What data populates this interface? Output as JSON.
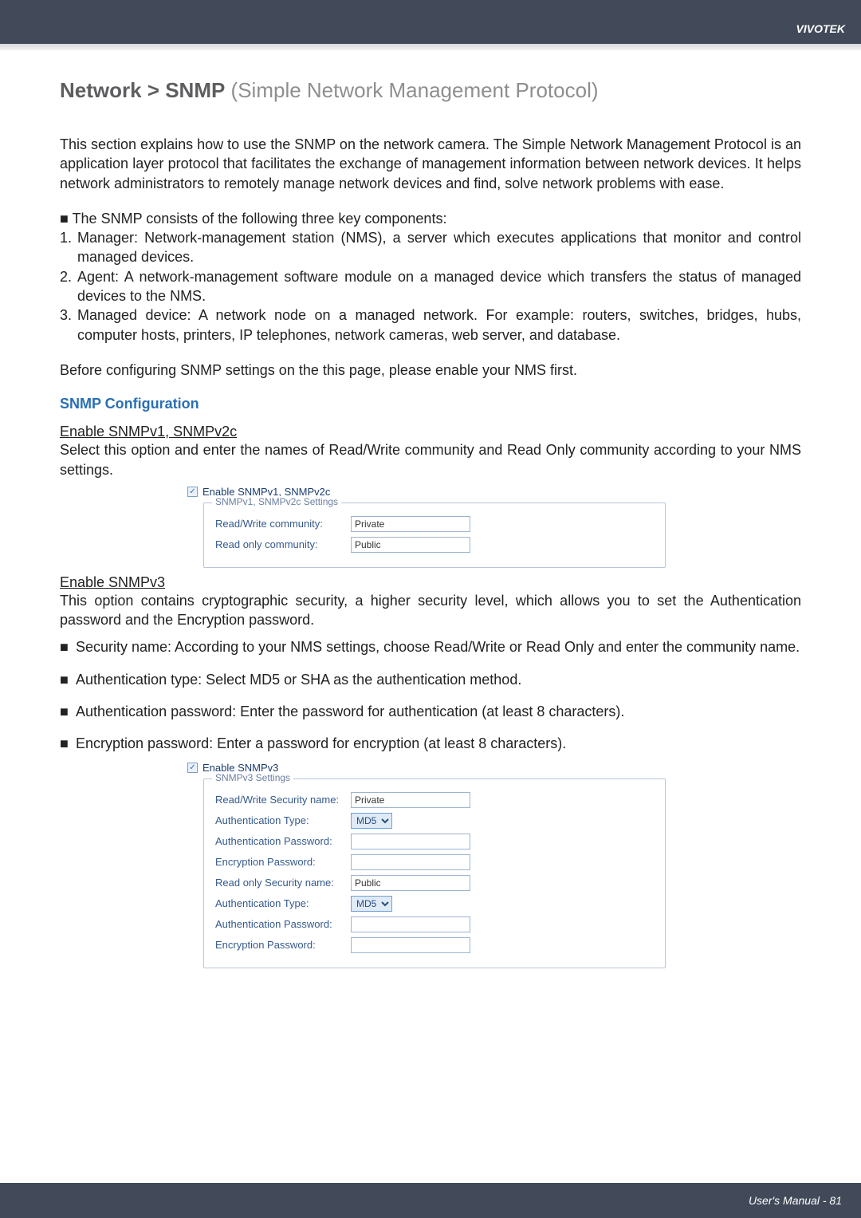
{
  "header": {
    "brand": "VIVOTEK"
  },
  "title": {
    "strong": "Network > SNMP",
    "light": " (Simple Network Management Protocol)"
  },
  "intro": "This section explains how to use the SNMP on the network camera. The Simple Network Management Protocol is an application layer protocol that facilitates the exchange of management information between network devices. It helps network administrators to remotely manage network devices and find, solve network problems with ease.",
  "components_lead": "■ The SNMP consists of the following three key components:",
  "components": [
    "Manager: Network-management station (NMS), a server which executes applications that monitor and control managed devices.",
    "Agent: A network-management software module on a managed device which transfers the status of managed devices to the NMS.",
    "Managed device: A network node on a managed network. For example: routers, switches, bridges, hubs, computer hosts, printers, IP telephones, network cameras, web server, and database."
  ],
  "before": "Before configuring SNMP settings on the this page, please enable your NMS first.",
  "snmp_config_hd": "SNMP Configuration",
  "v1v2": {
    "head": "Enable SNMPv1, SNMPv2c",
    "desc": "Select this option and enter the names of Read/Write community and Read Only community according to your NMS settings.",
    "cb_label": "Enable SNMPv1, SNMPv2c",
    "legend": "SNMPv1, SNMPv2c Settings",
    "rw_label": "Read/Write community:",
    "rw_value": "Private",
    "ro_label": "Read only community:",
    "ro_value": "Public"
  },
  "v3": {
    "head": "Enable SNMPv3",
    "desc": "This option contains cryptographic security, a higher security level, which allows you to set the Authentication password and the Encryption password.",
    "bullets": [
      "Security name: According to your NMS settings, choose Read/Write or Read Only and enter the community name.",
      "Authentication type: Select MD5 or SHA as the authentication method.",
      "Authentication password: Enter the password for authentication (at least 8 characters).",
      "Encryption password: Enter a password for encryption (at least 8 characters)."
    ],
    "cb_label": "Enable SNMPv3",
    "legend": "SNMPv3 Settings",
    "rows": {
      "rw_sec": {
        "label": "Read/Write Security name:",
        "value": "Private"
      },
      "auth_type1": {
        "label": "Authentication Type:",
        "value": "MD5"
      },
      "auth_pw1": {
        "label": "Authentication Password:",
        "value": ""
      },
      "enc_pw1": {
        "label": "Encryption Password:",
        "value": ""
      },
      "ro_sec": {
        "label": "Read only Security name:",
        "value": "Public"
      },
      "auth_type2": {
        "label": "Authentication Type:",
        "value": "MD5"
      },
      "auth_pw2": {
        "label": "Authentication Password:",
        "value": ""
      },
      "enc_pw2": {
        "label": "Encryption Password:",
        "value": ""
      }
    }
  },
  "footer": "User's Manual - 81"
}
